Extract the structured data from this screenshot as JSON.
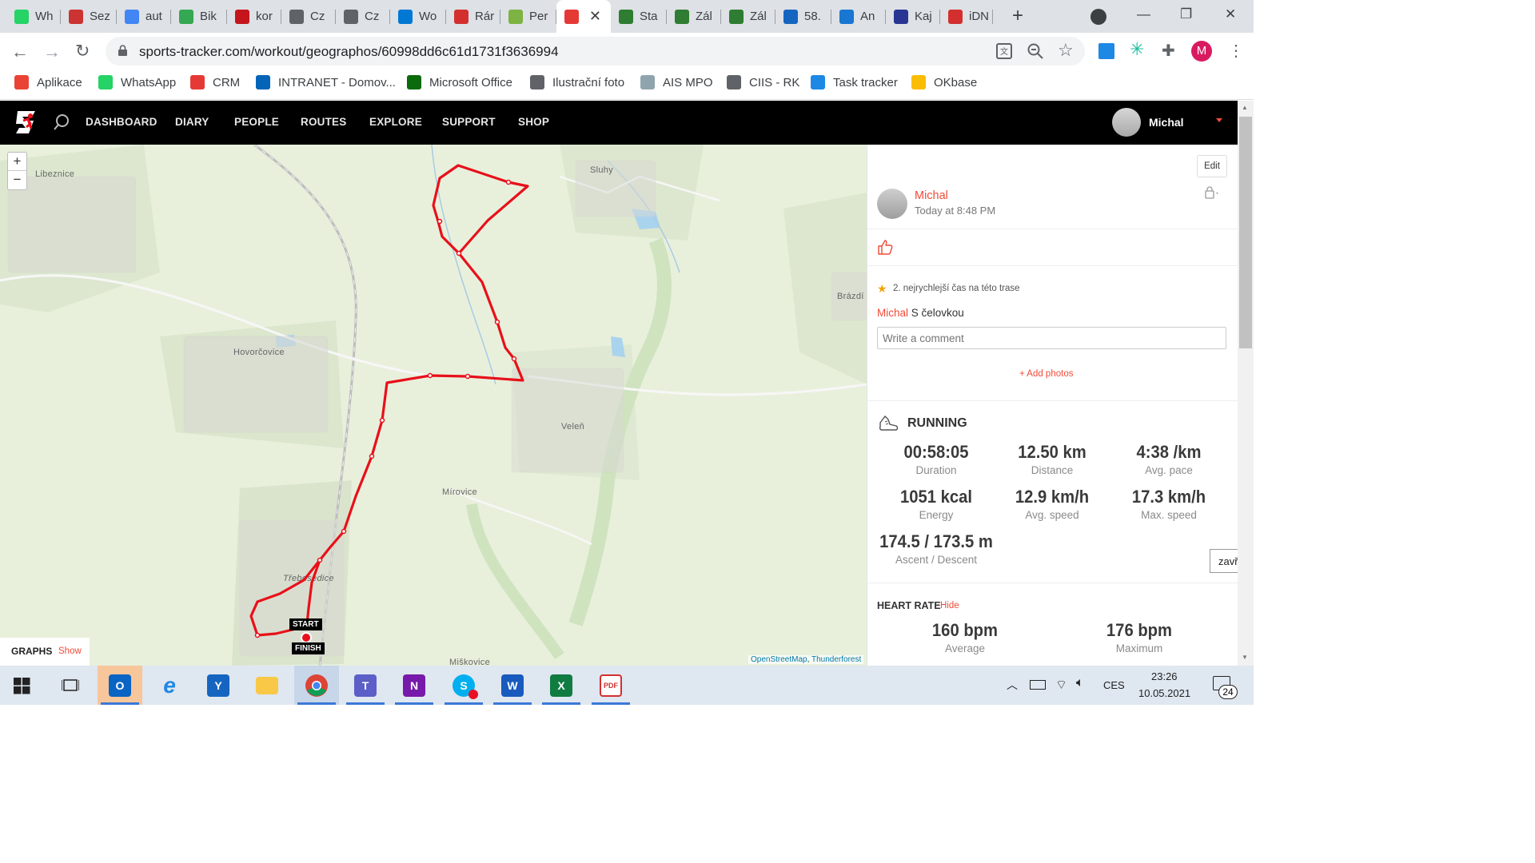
{
  "browser": {
    "tabs": [
      {
        "label": "Wh",
        "icon": "whatsapp-icon",
        "color": "#25d366"
      },
      {
        "label": "Sez",
        "icon": "seznam-icon",
        "color": "#c33"
      },
      {
        "label": "aut",
        "icon": "google-icon",
        "color": "#4285f4"
      },
      {
        "label": "Bik",
        "icon": "maps-pin-icon",
        "color": "#34a853"
      },
      {
        "label": "kor",
        "icon": "br-logo-icon",
        "color": "#c4161c"
      },
      {
        "label": "Cz",
        "icon": "globe-icon",
        "color": "#5f6368"
      },
      {
        "label": "Cz",
        "icon": "globe-icon",
        "color": "#5f6368"
      },
      {
        "label": "Wo",
        "icon": "task-check-icon",
        "color": "#0078d4"
      },
      {
        "label": "Rár",
        "icon": "info-i-icon",
        "color": "#d32f2f"
      },
      {
        "label": "Per",
        "icon": "m-circle-icon",
        "color": "#7cb342"
      },
      {
        "label": "",
        "icon": "runner-icon",
        "color": "#e53935",
        "active": true
      },
      {
        "label": "Sta",
        "icon": "cssz-icon",
        "color": "#2e7d32"
      },
      {
        "label": "Zál",
        "icon": "cssz-icon",
        "color": "#2e7d32"
      },
      {
        "label": "Zál",
        "icon": "cssz-icon",
        "color": "#2e7d32"
      },
      {
        "label": "58.",
        "icon": "z-letter-icon",
        "color": "#1565c0"
      },
      {
        "label": "An",
        "icon": "gear-network-icon",
        "color": "#1976d2"
      },
      {
        "label": "Kaj",
        "icon": "shield-icon",
        "color": "#283593"
      },
      {
        "label": "iDN",
        "icon": "info-i-icon",
        "color": "#d32f2f"
      }
    ],
    "new_tab": "+",
    "url": "sports-tracker.com/workout/geographos/60998dd6c61d1731f3636994",
    "profile_initial": "M",
    "bookmarks": [
      {
        "label": "Aplikace",
        "icon": "apps-grid-icon"
      },
      {
        "label": "WhatsApp",
        "icon": "whatsapp-icon"
      },
      {
        "label": "CRM",
        "icon": "crm-icon"
      },
      {
        "label": "INTRANET - Domov...",
        "icon": "sharepoint-icon"
      },
      {
        "label": "Microsoft Office",
        "icon": "office-icon"
      },
      {
        "label": "Ilustrační foto",
        "icon": "globe-icon"
      },
      {
        "label": "AIS MPO",
        "icon": "ais-icon"
      },
      {
        "label": "CIIS - RK",
        "icon": "globe-icon"
      },
      {
        "label": "Task tracker",
        "icon": "task-check-icon"
      },
      {
        "label": "OKbase",
        "icon": "okbase-icon"
      }
    ]
  },
  "site": {
    "nav": [
      "DASHBOARD",
      "DIARY",
      "PEOPLE",
      "ROUTES",
      "EXPLORE",
      "SUPPORT",
      "SHOP"
    ],
    "user_name": "Michal"
  },
  "map": {
    "zoom_in": "+",
    "zoom_out": "−",
    "places": [
      "Libeznice",
      "Sluhy",
      "Brázdí",
      "Hovorčovice",
      "Veleň",
      "Mírovice",
      "Třebosedice",
      "Miškovice"
    ],
    "start_label": "START",
    "finish_label": "FINISH",
    "attribution_osm": "OpenStreetMap",
    "attribution_sep": ",",
    "attribution_tf": "Thunderforest",
    "graphs_label": "GRAPHS",
    "graphs_show": "Show"
  },
  "workout": {
    "edit_label": "Edit",
    "author": "Michal",
    "time": "Today at 8:48 PM",
    "achievement": "2. nejrychlejší čas na této trase",
    "comment_author": "Michal",
    "comment_text": "S čelovkou",
    "comment_placeholder": "Write a comment",
    "add_photos": "+ Add photos",
    "activity": "RUNNING",
    "stats": [
      {
        "value": "00:58:05",
        "label": "Duration"
      },
      {
        "value": "12.50 km",
        "label": "Distance"
      },
      {
        "value": "4:38 /km",
        "label": "Avg. pace"
      },
      {
        "value": "1051 kcal",
        "label": "Energy"
      },
      {
        "value": "12.9 km/h",
        "label": "Avg. speed"
      },
      {
        "value": "17.3 km/h",
        "label": "Max. speed"
      },
      {
        "value": "174.5 / 173.5 m",
        "label": "Ascent / Descent"
      }
    ],
    "heart_rate_title": "HEART RATE",
    "heart_rate_hide": "Hide",
    "heart_rate": [
      {
        "value": "160 bpm",
        "label": "Average"
      },
      {
        "value": "176 bpm",
        "label": "Maximum"
      }
    ],
    "close_popup": "zavřít"
  },
  "taskbar": {
    "apps": [
      "outlook",
      "internet-explorer",
      "yammer",
      "file-explorer",
      "chrome",
      "teams",
      "onenote",
      "skype",
      "word",
      "excel",
      "pdf"
    ],
    "language": "CES",
    "time": "23:26",
    "date": "10.05.2021",
    "notifications": "24"
  },
  "colors": {
    "accent": "#f04b37",
    "route": "#e8101a",
    "nav_bg": "#000000"
  }
}
